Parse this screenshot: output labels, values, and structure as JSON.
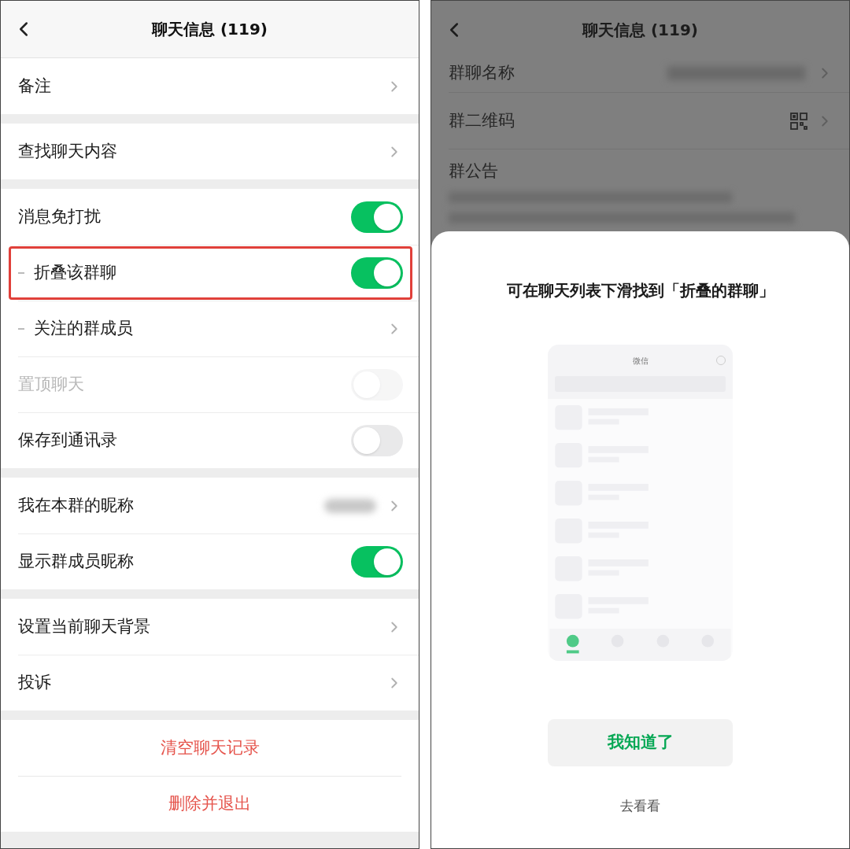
{
  "left": {
    "header": {
      "title": "聊天信息 (119)"
    },
    "sections": [
      {
        "rows": [
          {
            "label": "备注",
            "kind": "chevron"
          }
        ]
      },
      {
        "rows": [
          {
            "label": "查找聊天内容",
            "kind": "chevron"
          }
        ]
      },
      {
        "rows": [
          {
            "label": "消息免打扰",
            "kind": "toggle",
            "on": true
          },
          {
            "label": "折叠该群聊",
            "kind": "toggle",
            "on": true,
            "sub": true,
            "highlighted": true
          },
          {
            "label": "关注的群成员",
            "kind": "chevron",
            "sub": true
          },
          {
            "label": "置顶聊天",
            "kind": "toggle",
            "on": false,
            "disabled": true
          },
          {
            "label": "保存到通讯录",
            "kind": "toggle",
            "on": false
          }
        ]
      },
      {
        "rows": [
          {
            "label": "我在本群的昵称",
            "kind": "chevron",
            "blurred_value": true
          },
          {
            "label": "显示群成员昵称",
            "kind": "toggle",
            "on": true
          }
        ]
      },
      {
        "rows": [
          {
            "label": "设置当前聊天背景",
            "kind": "chevron"
          },
          {
            "label": "投诉",
            "kind": "chevron"
          }
        ]
      },
      {
        "rows": [
          {
            "label": "清空聊天记录",
            "kind": "action"
          },
          {
            "label": "删除并退出",
            "kind": "action"
          }
        ]
      }
    ]
  },
  "right": {
    "header": {
      "title": "聊天信息 (119)"
    },
    "rows": [
      {
        "label": "群聊名称",
        "kind": "blurred"
      },
      {
        "label": "群二维码",
        "kind": "qr"
      },
      {
        "label": "群公告",
        "kind": "notice"
      }
    ],
    "sheet": {
      "title": "可在聊天列表下滑找到「折叠的群聊」",
      "preview": {
        "title": "微信"
      },
      "primary_button": "我知道了",
      "secondary_link": "去看看"
    }
  }
}
